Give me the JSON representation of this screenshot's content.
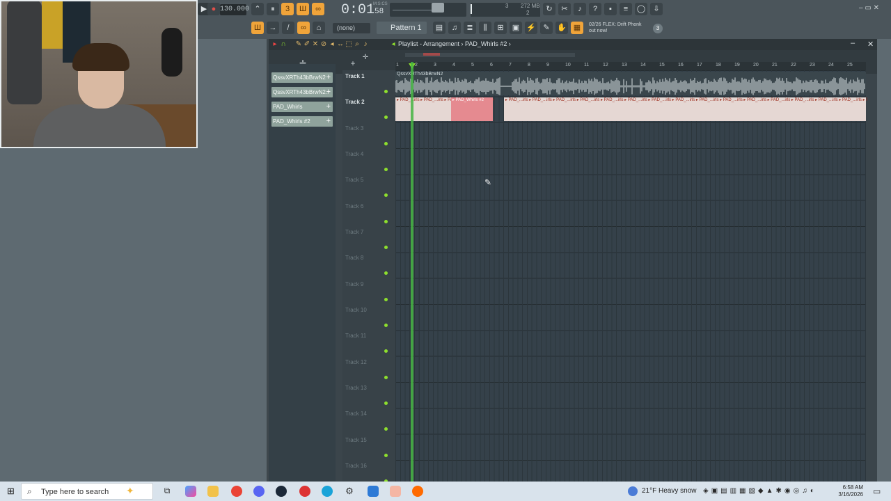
{
  "toolbar": {
    "bpm": "130.000",
    "time_main": "0:01",
    "time_sub": "58",
    "time_unit": "M:S:CS",
    "memory": "272 MB",
    "cpu_num": "3",
    "poly_num": "2",
    "pattern_none": "(none)",
    "pattern_selected": "Pattern 1",
    "hint_line1": "02/26 FLEX: Drift Phonk",
    "hint_line2": "out now!",
    "hint_badge": "3",
    "win_controls": "– ▭ ✕"
  },
  "playlist": {
    "title": "Playlist - Arrangement › PAD_Whirls #2 ›",
    "close": "✕",
    "minimize": "–",
    "picker": [
      "QssvXRTh43bBrwN2",
      "QssvXRTh43bBrwN2..",
      "PAD_Whirls",
      "PAD_Whirls #2"
    ],
    "ruler": [
      "1",
      "2",
      "3",
      "4",
      "5",
      "6",
      "7",
      "8",
      "9",
      "10",
      "11",
      "12",
      "13",
      "14",
      "15",
      "16",
      "17",
      "18",
      "19",
      "20",
      "21",
      "22",
      "23",
      "24",
      "25"
    ],
    "tracks": [
      "Track 1",
      "Track 2",
      "Track 3",
      "Track 4",
      "Track 5",
      "Track 6",
      "Track 7",
      "Track 8",
      "Track 9",
      "Track 10",
      "Track 11",
      "Track 12",
      "Track 13",
      "Track 14",
      "Track 15",
      "Track 16"
    ],
    "clip1_name": "QssvXRTh43bBrwN2",
    "clip2_short": "PAD_...irls",
    "clip2_selected": "PAD_Whirls #2"
  },
  "taskbar": {
    "search_placeholder": "Type here to search",
    "weather_temp": "21°F",
    "weather_desc": "Heavy snow",
    "time": "6:58 AM",
    "date": "3/16/2026"
  },
  "colors": {
    "accent_orange": "#f0a43a",
    "led_green": "#8ee02d",
    "clip_selected": "#e58a90",
    "clip_pad": "#e5d7d3"
  }
}
